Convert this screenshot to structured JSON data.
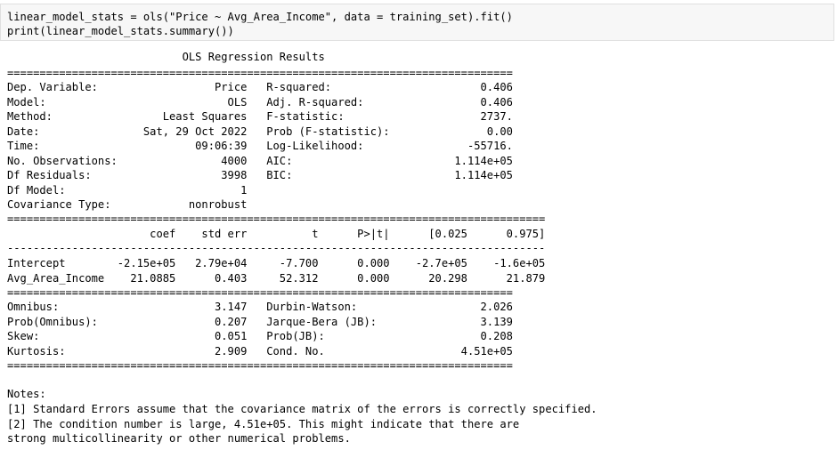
{
  "code_cell": {
    "lines": [
      "linear_model_stats = ols(\"Price ~ Avg_Area_Income\", data = training_set).fit()",
      "print(linear_model_stats.summary())"
    ]
  },
  "output": {
    "title": "                           OLS Regression Results                            ",
    "summary_rows": [
      "Dep. Variable:                  Price   R-squared:                       0.406",
      "Model:                            OLS   Adj. R-squared:                  0.406",
      "Method:                 Least Squares   F-statistic:                     2737.",
      "Date:                Sat, 29 Oct 2022   Prob (F-statistic):               0.00",
      "Time:                        09:06:39   Log-Likelihood:                -55716.",
      "No. Observations:                4000   AIC:                         1.114e+05",
      "Df Residuals:                    3998   BIC:                         1.114e+05",
      "Df Model:                           1                                         ",
      "Covariance Type:            nonrobust                                         "
    ],
    "coef_header": "                      coef    std err          t      P>|t|      [0.025      0.975]",
    "coef_rows": [
      "Intercept        -2.15e+05   2.79e+04     -7.700      0.000    -2.7e+05    -1.6e+05",
      "Avg_Area_Income    21.0885      0.403     52.312      0.000      20.298      21.879"
    ],
    "diag_rows": [
      "Omnibus:                        3.147   Durbin-Watson:                   2.026",
      "Prob(Omnibus):                  0.207   Jarque-Bera (JB):                3.139",
      "Skew:                           0.051   Prob(JB):                        0.208",
      "Kurtosis:                       2.909   Cond. No.                     4.51e+05"
    ],
    "sep_eq_short": "==============================================================================",
    "sep_eq_long": "===================================================================================",
    "sep_dash_long": "-----------------------------------------------------------------------------------",
    "notes_title": "Notes:",
    "notes": [
      "[1] Standard Errors assume that the covariance matrix of the errors is correctly specified.",
      "[2] The condition number is large, 4.51e+05. This might indicate that there are",
      "strong multicollinearity or other numerical problems."
    ]
  }
}
